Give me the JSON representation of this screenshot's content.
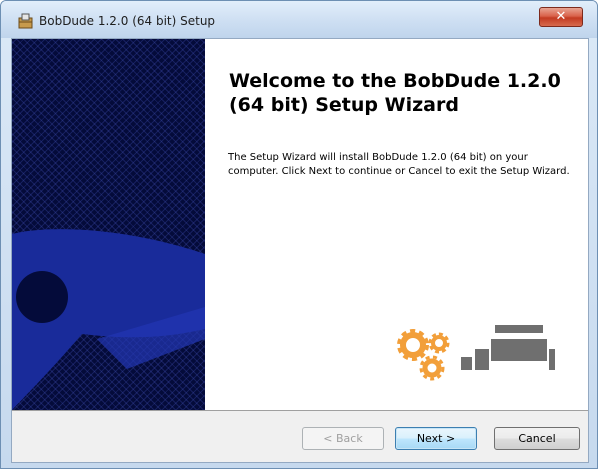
{
  "window": {
    "title": "BobDude 1.2.0 (64 bit) Setup",
    "close_label": "✕"
  },
  "wizard": {
    "heading": "Welcome to the BobDude 1.2.0 (64 bit) Setup Wizard",
    "body": "The Setup Wizard will install BobDude 1.2.0 (64 bit) on your computer.  Click Next to continue or Cancel to exit the Setup Wizard."
  },
  "buttons": {
    "back": "< Back",
    "next": "Next >",
    "cancel": "Cancel"
  },
  "icons": {
    "title_icon": "installer-icon",
    "gears": "gears-icon",
    "hardware": "hardware-icon"
  },
  "colors": {
    "banner_dark": "#040b3a",
    "banner_shape": "#192b9a",
    "gear_orange": "#f29f3a",
    "hardware_gray": "#6f6f6f"
  }
}
